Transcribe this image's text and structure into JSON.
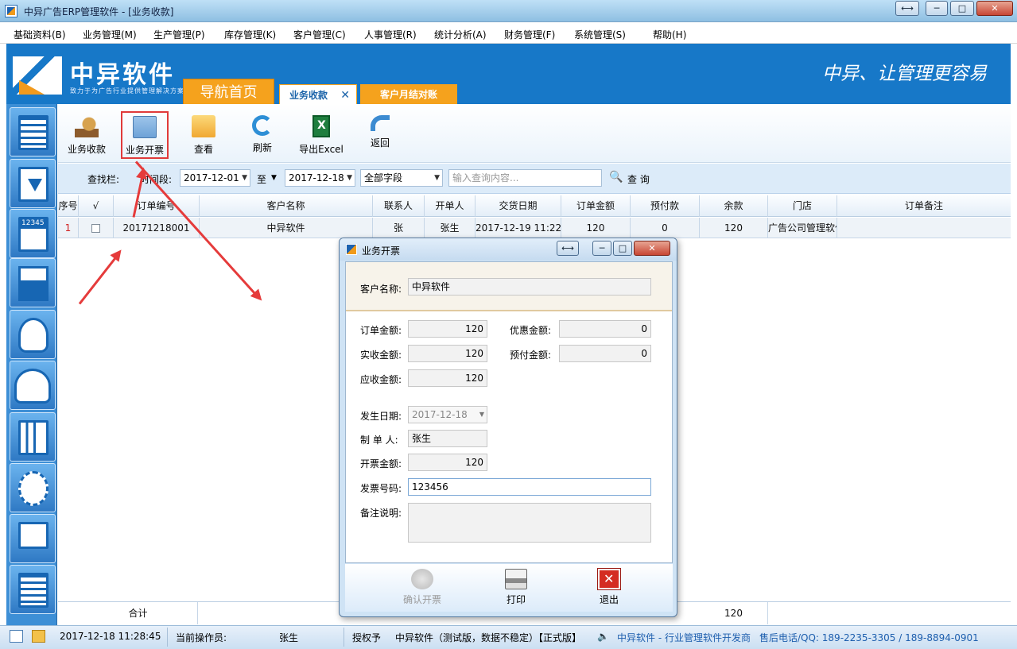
{
  "window": {
    "title": "中异广告ERP管理软件 - [业务收款]",
    "btn_restore": "⟷",
    "btn_min": "─",
    "btn_max": "□",
    "btn_close": "✕"
  },
  "menu": [
    "基础资料(B)",
    "业务管理(M)",
    "生产管理(P)",
    "库存管理(K)",
    "客户管理(C)",
    "人事管理(R)",
    "统计分析(A)",
    "财务管理(F)",
    "系统管理(S)",
    "帮助(H)"
  ],
  "banner": {
    "brand": "中异软件",
    "tagline": "致力于为广告行业提供管理解决方案",
    "slogan": "中异、让管理更容易"
  },
  "tabs": {
    "home": "导航首页",
    "current": "业务收款",
    "close": "✕",
    "other": "客户月结对账"
  },
  "toolbar": [
    {
      "label": "业务收款",
      "icon": "money-hand-icon"
    },
    {
      "label": "业务开票",
      "icon": "invoice-icon"
    },
    {
      "label": "查看",
      "icon": "folder-icon"
    },
    {
      "label": "刷新",
      "icon": "refresh-icon"
    },
    {
      "label": "导出Excel",
      "icon": "excel-icon"
    },
    {
      "label": "返回",
      "icon": "back-arrow-icon"
    }
  ],
  "filter": {
    "label": "查找栏:",
    "period_label": "时间段:",
    "date_from": "2017-12-01",
    "to_label": "至",
    "date_to": "2017-12-18",
    "field": "全部字段",
    "search_placeholder": "输入查询内容...",
    "search_button": "查 询"
  },
  "table": {
    "headers": [
      "序号",
      "√",
      "订单编号",
      "客户名称",
      "联系人",
      "开单人",
      "交货日期",
      "订单金额",
      "预付款",
      "余款",
      "门店",
      "订单备注"
    ],
    "rows": [
      {
        "no": "1",
        "order_id": "20171218001",
        "customer": "中异软件",
        "contact": "张",
        "creator": "张生",
        "delivery": "2017-12-19 11:22",
        "amount": "120",
        "prepaid": "0",
        "balance": "120",
        "store": "广告公司管理软件",
        "remark": ""
      }
    ],
    "footer": {
      "label": "合计",
      "balance_total": "120"
    }
  },
  "status": {
    "datetime": "2017-12-18 11:28:45",
    "operator_label": "当前操作员:",
    "operator": "张生",
    "licensed_label": "授权予",
    "edition": "中异软件（测试版，数据不稳定）【正式版】",
    "company": "中异软件 - 行业管理软件开发商",
    "phone": "售后电话/QQ: 189-2235-3305  / 189-8894-0901"
  },
  "dialog": {
    "title": "业务开票",
    "customer_label": "客户名称:",
    "customer": "中异软件",
    "order_amount_label": "订单金额:",
    "order_amount": "120",
    "discount_label": "优惠金额:",
    "discount": "0",
    "received_label": "实收金额:",
    "received": "120",
    "prepaid_label": "预付金额:",
    "prepaid": "0",
    "receivable_label": "应收金额:",
    "receivable": "120",
    "date_label": "发生日期:",
    "date": "2017-12-18",
    "maker_label": "制 单 人:",
    "maker": "张生",
    "invoice_amount_label": "开票金额:",
    "invoice_amount": "120",
    "invoice_no_label": "发票号码:",
    "invoice_no": "123456",
    "remark_label": "备注说明:",
    "confirm": "确认开票",
    "print": "打印",
    "exit": "退出",
    "btn_restore": "⟷",
    "btn_min": "─",
    "btn_max": "□",
    "btn_close": "✕"
  },
  "colors": {
    "brand_blue": "#1778c8",
    "accent_orange": "#f5a21d",
    "annotation_red": "#e53b3b"
  }
}
